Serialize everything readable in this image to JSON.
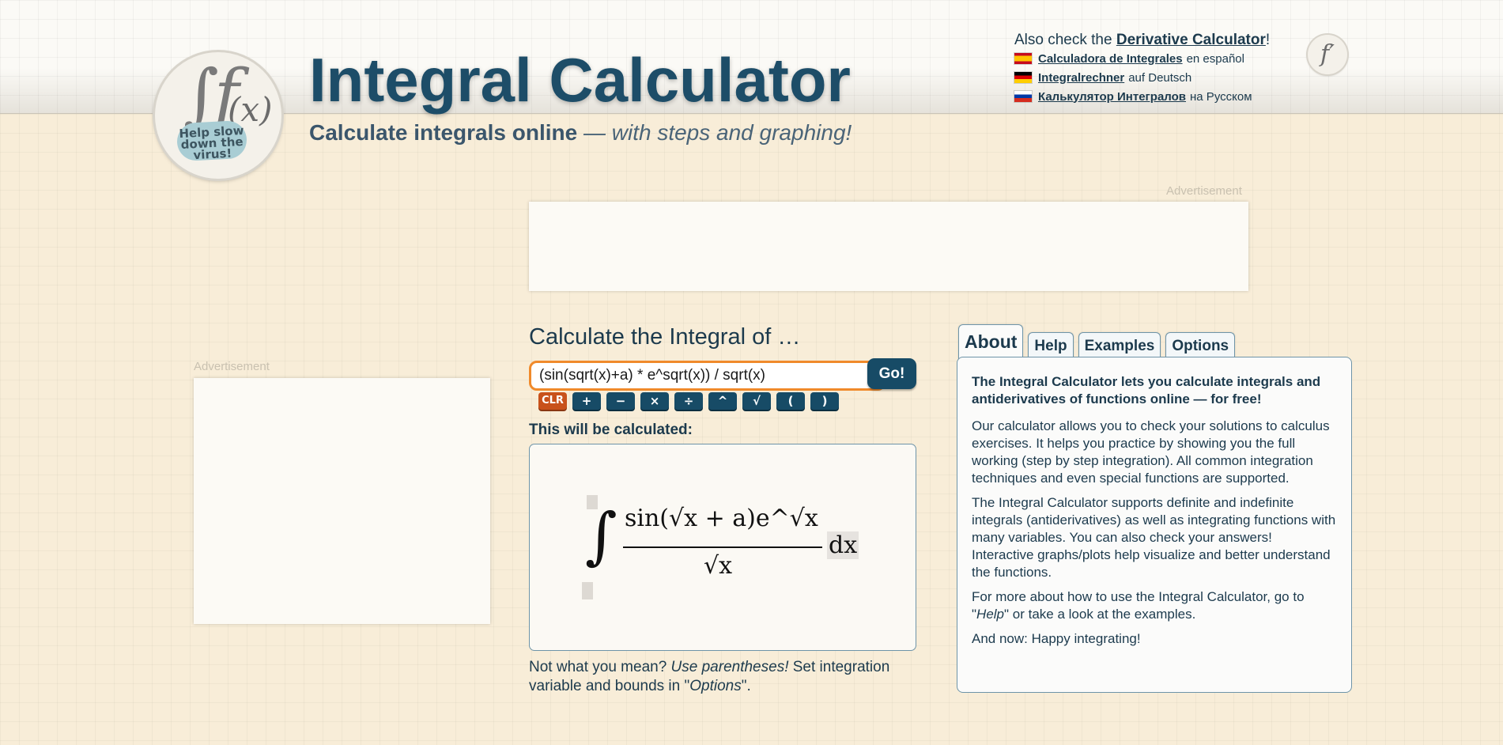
{
  "header": {
    "title": "Integral Calculator",
    "subtitle_bold": "Calculate integrals online",
    "subtitle_italic": " — with steps and graphing!",
    "logo_badge": "Help slow down the virus!"
  },
  "languages": {
    "also_prefix": "Also check the ",
    "also_link": "Derivative Calculator",
    "also_suffix": "!",
    "items": [
      {
        "flag": "es",
        "link": "Calculadora de Integrales",
        "suffix": "en español"
      },
      {
        "flag": "de",
        "link": "Integralrechner",
        "suffix": "auf Deutsch"
      },
      {
        "flag": "ru",
        "link": "Калькулятор Интегралов",
        "suffix": "на Русском"
      }
    ]
  },
  "ads": {
    "label": "Advertisement"
  },
  "calculator": {
    "heading": "Calculate the Integral of …",
    "input_value": "(sin(sqrt(x)+a) * e^sqrt(x)) / sqrt(x)",
    "go_label": "Go!",
    "keys": [
      "CLR",
      "+",
      "−",
      "×",
      "÷",
      "^",
      "√",
      "(",
      ")"
    ],
    "preview_label": "This will be calculated:",
    "note_prefix": "Not what you mean? ",
    "note_italic": "Use parentheses!",
    "note_mid": " Set integration variable and bounds in \"",
    "note_options": "Options",
    "note_end": "\"."
  },
  "math": {
    "numerator": "sin(√x + a)e^√x",
    "denominator": "√x",
    "differential": "dx"
  },
  "tabs": [
    "About",
    "Help",
    "Examples",
    "Options"
  ],
  "about": {
    "lead": "The Integral Calculator lets you calculate integrals and antiderivatives of functions online — for free!",
    "p1": "Our calculator allows you to check your solutions to calculus exercises. It helps you practice by showing you the full working (step by step integration). All common integration techniques and even special functions are supported.",
    "p2": "The Integral Calculator supports definite and indefinite integrals (antiderivatives) as well as integrating functions with many variables. You can also check your answers! Interactive graphs/plots help visualize and better understand the functions.",
    "p3_prefix": "For more about how to use the Integral Calculator, go to \"",
    "p3_help": "Help",
    "p3_suffix": "\" or take a look at the examples.",
    "p4": "And now: Happy integrating!"
  },
  "colors": {
    "background": "#f8edd8",
    "brand_blue": "#174b66",
    "input_focus": "#f08a2b",
    "clear_key": "#c8511b"
  }
}
